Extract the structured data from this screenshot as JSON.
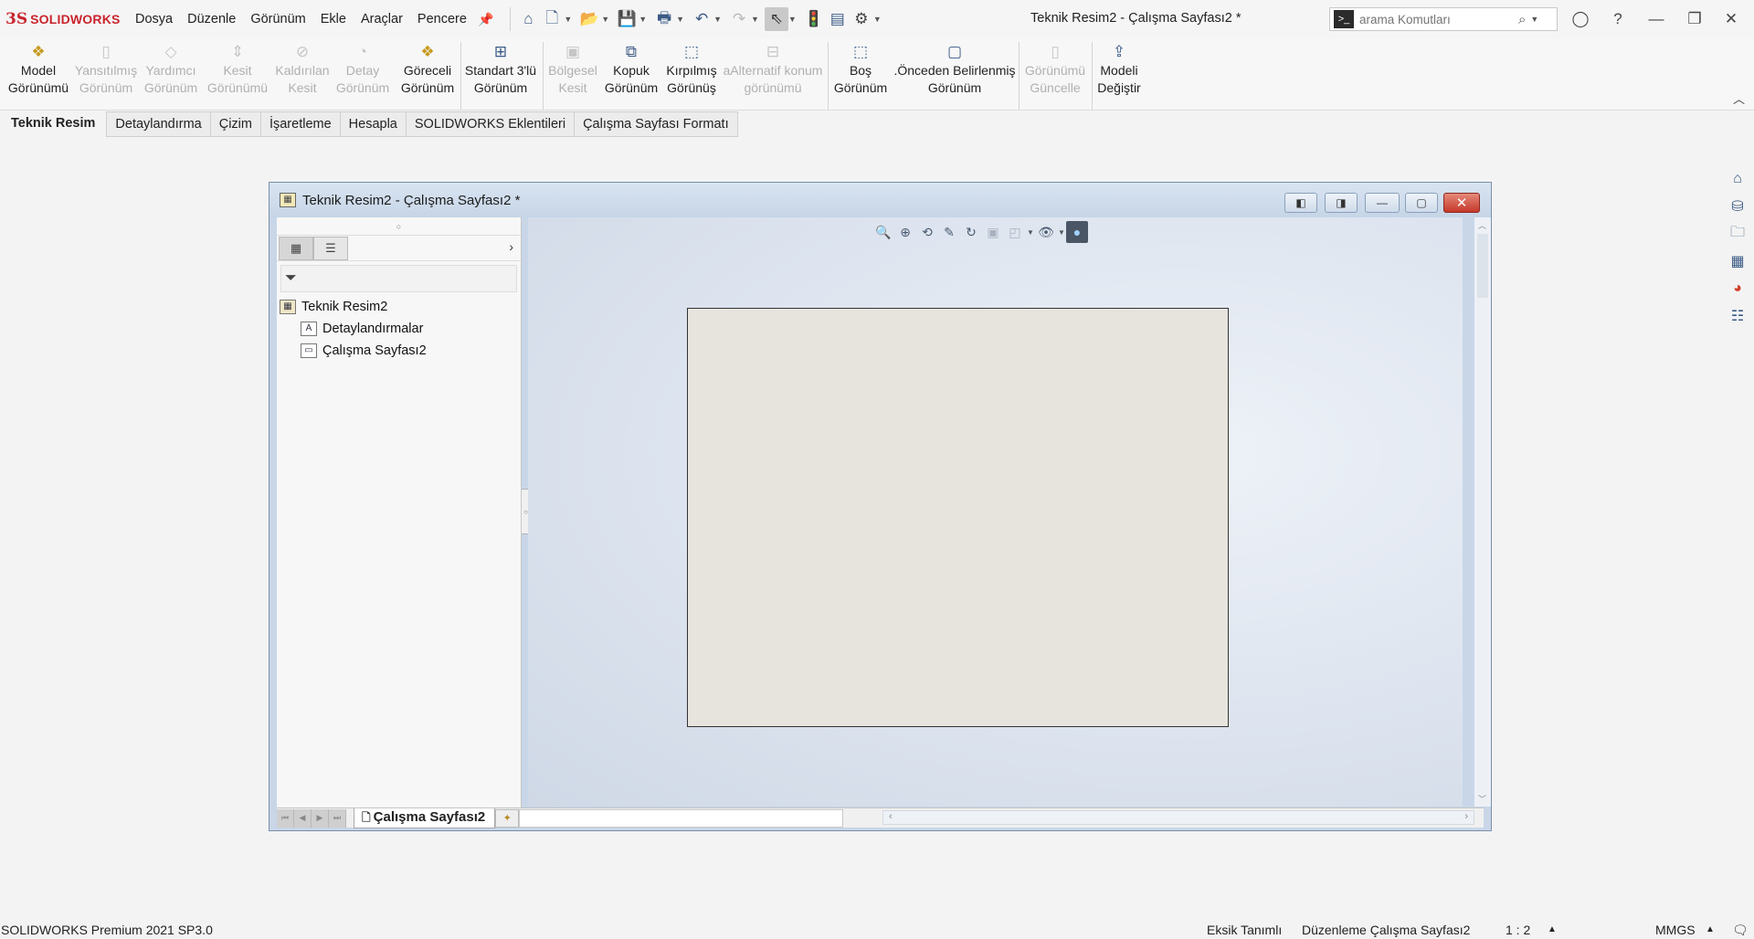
{
  "app": {
    "logo_mark": "3S",
    "logo_text": "SOLIDWORKS",
    "menu": [
      "Dosya",
      "Düzenle",
      "Görünüm",
      "Ekle",
      "Araçlar",
      "Pencere"
    ],
    "window_title": "Teknik Resim2 - Çalışma Sayfası2 *",
    "search_placeholder": "arama Komutları"
  },
  "ribbon": {
    "buttons": [
      {
        "line1": "Model",
        "line2": "Görünümü",
        "enabled": true,
        "icon": "model-view-icon"
      },
      {
        "line1": "Yansıtılmış",
        "line2": "Görünüm",
        "enabled": false,
        "icon": "projected-view-icon"
      },
      {
        "line1": "Yardımcı",
        "line2": "Görünüm",
        "enabled": false,
        "icon": "auxiliary-view-icon"
      },
      {
        "line1": "Kesit",
        "line2": "Görünümü",
        "enabled": false,
        "icon": "section-view-icon"
      },
      {
        "line1": "Kaldırılan",
        "line2": "Kesit",
        "enabled": false,
        "icon": "removed-section-icon"
      },
      {
        "line1": "Detay",
        "line2": "Görünüm",
        "enabled": false,
        "icon": "detail-view-icon"
      },
      {
        "line1": "Göreceli",
        "line2": "Görünüm",
        "enabled": true,
        "icon": "relative-view-icon"
      },
      {
        "line1": "Standart 3'lü",
        "line2": "Görünüm",
        "enabled": true,
        "icon": "standard-3-view-icon"
      },
      {
        "line1": "Bölgesel",
        "line2": "Kesit",
        "enabled": false,
        "icon": "broken-out-section-icon"
      },
      {
        "line1": "Kopuk",
        "line2": "Görünüm",
        "enabled": true,
        "icon": "break-view-icon"
      },
      {
        "line1": "Kırpılmış",
        "line2": "Görünüş",
        "enabled": true,
        "icon": "crop-view-icon"
      },
      {
        "line1": "aAlternatif konum",
        "line2": "görünümü",
        "enabled": false,
        "icon": "alternate-position-icon"
      },
      {
        "line1": "Boş",
        "line2": "Görünüm",
        "enabled": true,
        "icon": "empty-view-icon"
      },
      {
        "line1": ".Önceden Belirlenmiş",
        "line2": "Görünüm",
        "enabled": true,
        "icon": "predefined-view-icon"
      },
      {
        "line1": "Görünümü",
        "line2": "Güncelle",
        "enabled": false,
        "icon": "update-views-icon"
      },
      {
        "line1": "Modeli",
        "line2": "Değiştir",
        "enabled": true,
        "icon": "replace-model-icon"
      }
    ]
  },
  "tabs": [
    "Teknik Resim",
    "Detaylandırma",
    "Çizim",
    "İşaretleme",
    "Hesapla",
    "SOLIDWORKS Eklentileri",
    "Çalışma Sayfası Formatı"
  ],
  "document": {
    "title": "Teknik Resim2 - Çalışma Sayfası2 *",
    "tree": [
      {
        "label": "Teknik Resim2",
        "icon": "drawing-icon"
      },
      {
        "label": "Detaylandırmalar",
        "icon": "annotations-icon"
      },
      {
        "label": "Çalışma Sayfası2",
        "icon": "sheet-icon"
      }
    ],
    "sheet_tab": "Çalışma Sayfası2"
  },
  "status": {
    "product": "SOLIDWORKS Premium 2021 SP3.0",
    "definition": "Eksik Tanımlı",
    "mode": "Düzenleme Çalışma Sayfası2",
    "scale": "1 : 2",
    "units": "MMGS"
  },
  "colors": {
    "brand_red": "#c9252d",
    "canvas_bg": "#dde4ef",
    "sheet_fill": "#e6e4dd"
  }
}
